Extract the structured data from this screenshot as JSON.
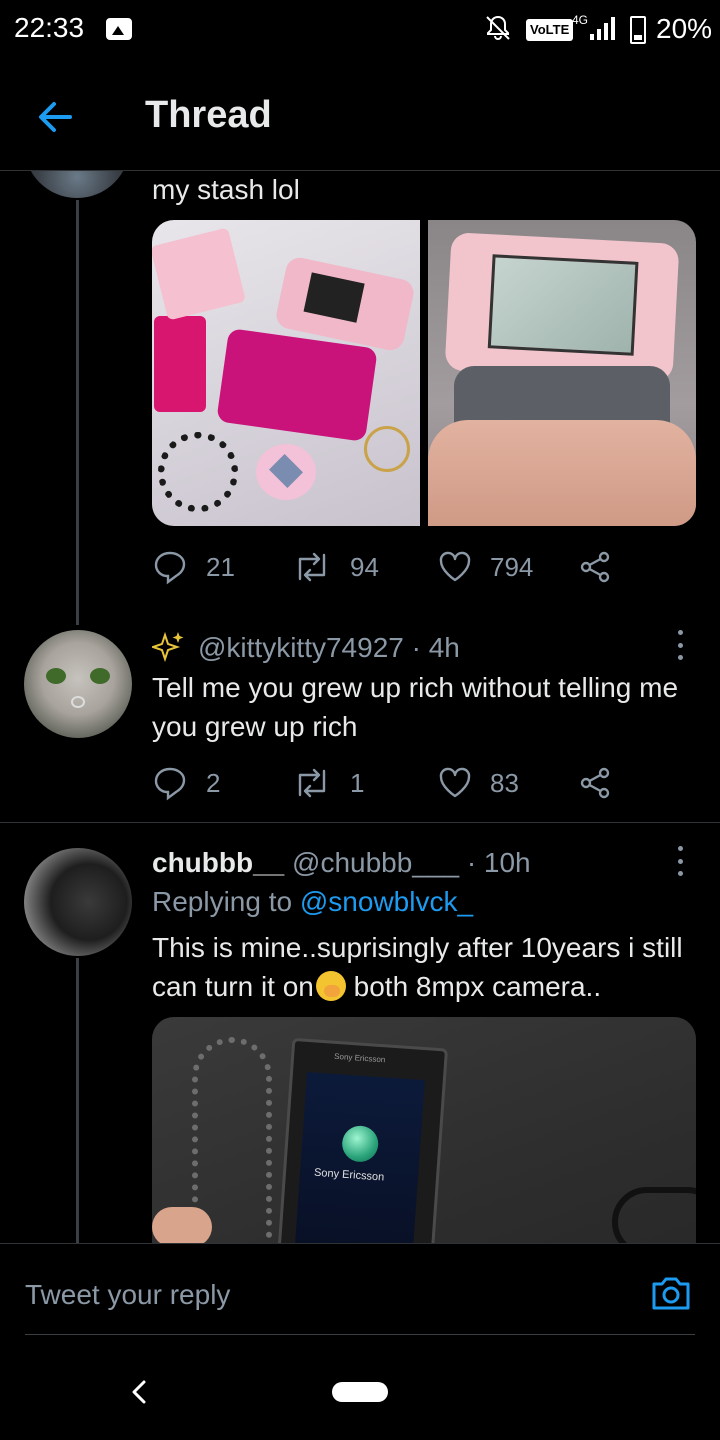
{
  "status_bar": {
    "time": "22:33",
    "volte": "VoLTE",
    "network": "4G",
    "battery": "20%",
    "icons": [
      "gallery-icon",
      "notifications-off-icon",
      "signal-icon",
      "battery-icon"
    ]
  },
  "header": {
    "title": "Thread"
  },
  "tweets": [
    {
      "text": "my stash lol",
      "stats": {
        "replies": "21",
        "retweets": "94",
        "likes": "794"
      }
    },
    {
      "handle": "@kittykitty74927",
      "time": "· 4h",
      "text": "Tell me you grew up rich without telling me you grew up rich",
      "stats": {
        "replies": "2",
        "retweets": "1",
        "likes": "83"
      }
    },
    {
      "name": "chubbb__",
      "handle": "@chubbb___",
      "time": "· 10h",
      "replying_prefix": "Replying to",
      "replying_to": "@snowblvck_",
      "text_1": "This is mine..suprisingly after 10years i still can turn it on",
      "text_2": " both 8mpx camera..",
      "media_text_brand": "Sony Ericsson",
      "media_text_top": "Sony Ericsson"
    }
  ],
  "reply_bar": {
    "placeholder": "Tweet your reply"
  },
  "colors": {
    "accent": "#1d9bf0",
    "background": "#000000",
    "muted": "#8b98a5",
    "divider": "#2f3336"
  }
}
